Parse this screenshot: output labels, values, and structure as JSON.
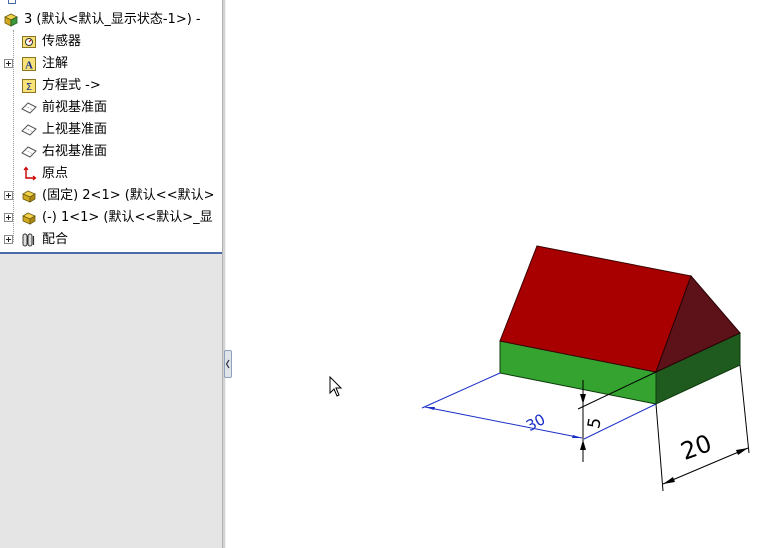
{
  "tree": {
    "items": [
      {
        "label": "3  (默认<默认_显示状态-1>) -",
        "icon": "assembly-icon",
        "expander": false
      },
      {
        "label": "传感器",
        "icon": "sensor-icon",
        "expander": false
      },
      {
        "label": "注解",
        "icon": "annotation-icon",
        "expander": true
      },
      {
        "label": "方程式 ->",
        "icon": "equation-icon",
        "expander": false
      },
      {
        "label": "前视基准面",
        "icon": "plane-icon",
        "expander": false
      },
      {
        "label": "上视基准面",
        "icon": "plane-icon",
        "expander": false
      },
      {
        "label": "右视基准面",
        "icon": "plane-icon",
        "expander": false
      },
      {
        "label": "原点",
        "icon": "origin-icon",
        "expander": false
      },
      {
        "label": "(固定) 2<1> (默认<<默认>",
        "icon": "part-icon",
        "expander": true
      },
      {
        "label": "(-) 1<1> (默认<<默认>_显",
        "icon": "part-icon",
        "expander": true
      },
      {
        "label": "配合",
        "icon": "mate-icon",
        "expander": true
      }
    ]
  },
  "viewport": {
    "dimensions": {
      "width_label": "30",
      "height_label": "5",
      "depth_label": "20"
    },
    "colors": {
      "roof_top": "#a80000",
      "roof_side": "#5c1218",
      "base_front": "#35a32f",
      "base_side": "#1f5a1f",
      "dimension_blue": "#1a2fc8",
      "dimension_black": "#000000"
    }
  },
  "cursor": {
    "icon": "mouse-pointer-icon"
  }
}
